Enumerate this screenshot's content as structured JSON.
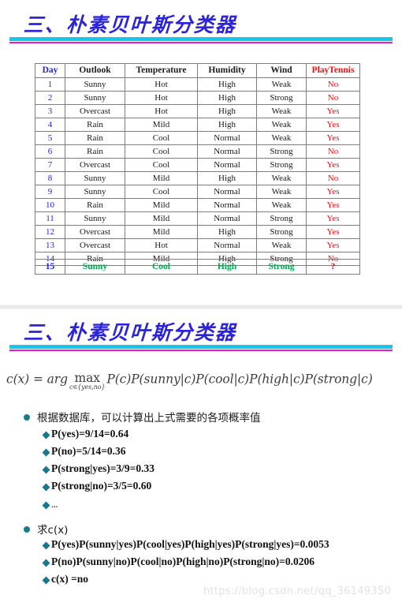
{
  "slide1": {
    "title": "三、朴素贝叶斯分类器",
    "rule_colors": {
      "cyan": "#19c5e8",
      "magenta": "#e01ce0"
    },
    "table": {
      "headers": [
        "Day",
        "Outlook",
        "Temperature",
        "Humidity",
        "Wind",
        "PlayTennis"
      ],
      "header_colors": [
        "#2222ee",
        "#1a1a1a",
        "#1a1a1a",
        "#1a1a1a",
        "#1a1a1a",
        "#fb0b0b"
      ],
      "rows": [
        [
          "1",
          "Sunny",
          "Hot",
          "High",
          "Weak",
          "No"
        ],
        [
          "2",
          "Sunny",
          "Hot",
          "High",
          "Strong",
          "No"
        ],
        [
          "3",
          "Overcast",
          "Hot",
          "High",
          "Weak",
          "Yes"
        ],
        [
          "4",
          "Rain",
          "Mild",
          "High",
          "Weak",
          "Yes"
        ],
        [
          "5",
          "Rain",
          "Cool",
          "Normal",
          "Weak",
          "Yes"
        ],
        [
          "6",
          "Rain",
          "Cool",
          "Normal",
          "Strong",
          "No"
        ],
        [
          "7",
          "Overcast",
          "Cool",
          "Normal",
          "Strong",
          "Yes"
        ],
        [
          "8",
          "Sunny",
          "Mild",
          "High",
          "Weak",
          "No"
        ],
        [
          "9",
          "Sunny",
          "Cool",
          "Normal",
          "Weak",
          "Yes"
        ],
        [
          "10",
          "Rain",
          "Mild",
          "Normal",
          "Weak",
          "Yes"
        ],
        [
          "11",
          "Sunny",
          "Mild",
          "Normal",
          "Strong",
          "Yes"
        ],
        [
          "12",
          "Overcast",
          "Mild",
          "High",
          "Strong",
          "Yes"
        ],
        [
          "13",
          "Overcast",
          "Hot",
          "Normal",
          "Weak",
          "Yes"
        ],
        [
          "14",
          "Rain",
          "Mild",
          "High",
          "Strong",
          "No"
        ]
      ],
      "query_row": [
        "15",
        "Sunny",
        "Cool",
        "High",
        "Strong",
        "?"
      ],
      "query_row_colors": [
        "#2222ee",
        "#00a84f",
        "#00a84f",
        "#00a84f",
        "#00a84f",
        "#fb0b0b"
      ]
    }
  },
  "slide2": {
    "title": "三、朴素贝叶斯分类器",
    "formula": {
      "lhs": "c(x) = arg",
      "max": "max",
      "subscript": "c∈{yes,no}",
      "rhs": "P(c)P(sunny|c)P(cool|c)P(high|c)P(strong|c)",
      "full": "c(x) = arg max_{c∈{yes,no}} P(c)P(sunny|c)P(cool|c)P(high|c)P(strong|c)"
    },
    "bullets": [
      {
        "level": 1,
        "text": "根据数据库，可以计算出上式需要的各项概率值"
      },
      {
        "level": 2,
        "text": "P(yes)=9/14=0.64"
      },
      {
        "level": 2,
        "text": "P(no)=5/14=0.36"
      },
      {
        "level": 2,
        "text": "P(strong|yes)=3/9=0.33"
      },
      {
        "level": 2,
        "text": "P(strong|no)=3/5=0.60"
      },
      {
        "level": 2,
        "text": "..."
      },
      {
        "level": 1,
        "text": "求c(x)"
      },
      {
        "level": 2,
        "text": "P(yes)P(sunny|yes)P(cool|yes)P(high|yes)P(strong|yes)=0.0053"
      },
      {
        "level": 2,
        "text": "P(no)P(sunny|no)P(cool|no)P(high|no)P(strong|no)=0.0206"
      },
      {
        "level": 2,
        "text": "c(x) =no"
      }
    ]
  },
  "watermark": "https://blog.csdn.net/qq_36149350"
}
